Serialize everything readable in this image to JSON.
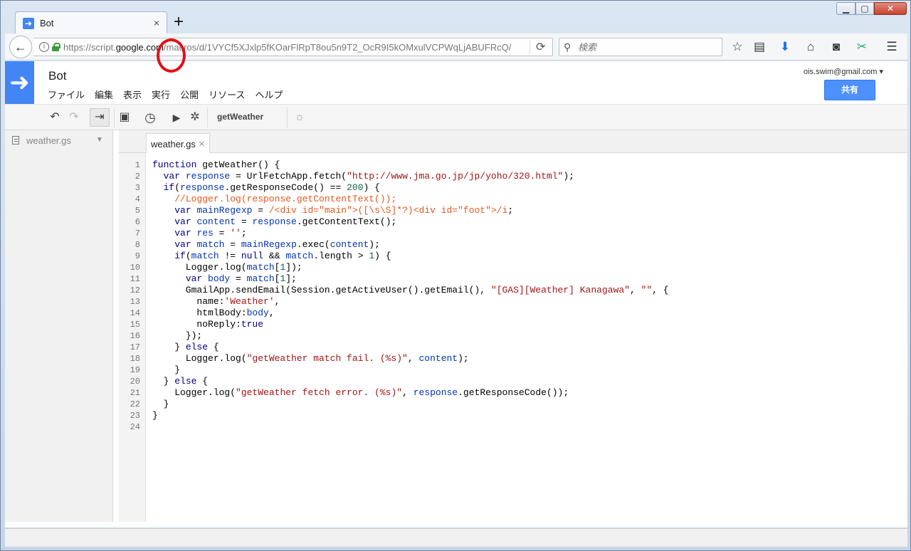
{
  "browser": {
    "tab_title": "Bot",
    "url_prefix": "https://script.",
    "url_domain": "google.com",
    "url_rest": "/macros/d/1VYCf5XJxlp5fKOarFlRpT8ou5n9T2_OcR9I5kOMxulVCPWqLjABUFRcQ/",
    "search_placeholder": "検索"
  },
  "app": {
    "project_title": "Bot",
    "menu": [
      "ファイル",
      "編集",
      "表示",
      "実行",
      "公開",
      "リソース",
      "ヘルプ"
    ],
    "account_email": "ois.swim@gmail.com",
    "share_label": "共有",
    "function_select": "getWeather"
  },
  "files": [
    {
      "name": "weather.gs"
    }
  ],
  "editor": {
    "tab": "weather.gs",
    "line_numbers": [
      "1",
      "2",
      "3",
      "4",
      "5",
      "6",
      "7",
      "8",
      "9",
      "10",
      "11",
      "12",
      "13",
      "14",
      "15",
      "16",
      "17",
      "18",
      "19",
      "20",
      "21",
      "22",
      "23",
      "24"
    ],
    "lines": [
      "function getWeather() {",
      "  var response = UrlFetchApp.fetch(\"http://www.jma.go.jp/jp/yoho/320.html\");",
      "  if(response.getResponseCode() == 200) {",
      "    //Logger.log(response.getContentText());",
      "    var mainRegexp = /<div id=\"main\">([\\s\\S]*?)<div id=\"foot\">/i;",
      "    var content = response.getContentText();",
      "    var res = '';",
      "    var match = mainRegexp.exec(content);",
      "    if(match != null && match.length > 1) {",
      "      Logger.log(match[1]);",
      "      var body = match[1];",
      "      GmailApp.sendEmail(Session.getActiveUser().getEmail(), \"[GAS][Weather] Kanagawa\", \"\", {",
      "        name:'Weather',",
      "        htmlBody:body,",
      "        noReply:true",
      "      });",
      "    } else {",
      "      Logger.log(\"getWeather match fail. (%s)\", content);",
      "    }",
      "  } else {",
      "    Logger.log(\"getWeather fetch error. (%s)\", response.getResponseCode());",
      "  }",
      "}",
      ""
    ]
  }
}
